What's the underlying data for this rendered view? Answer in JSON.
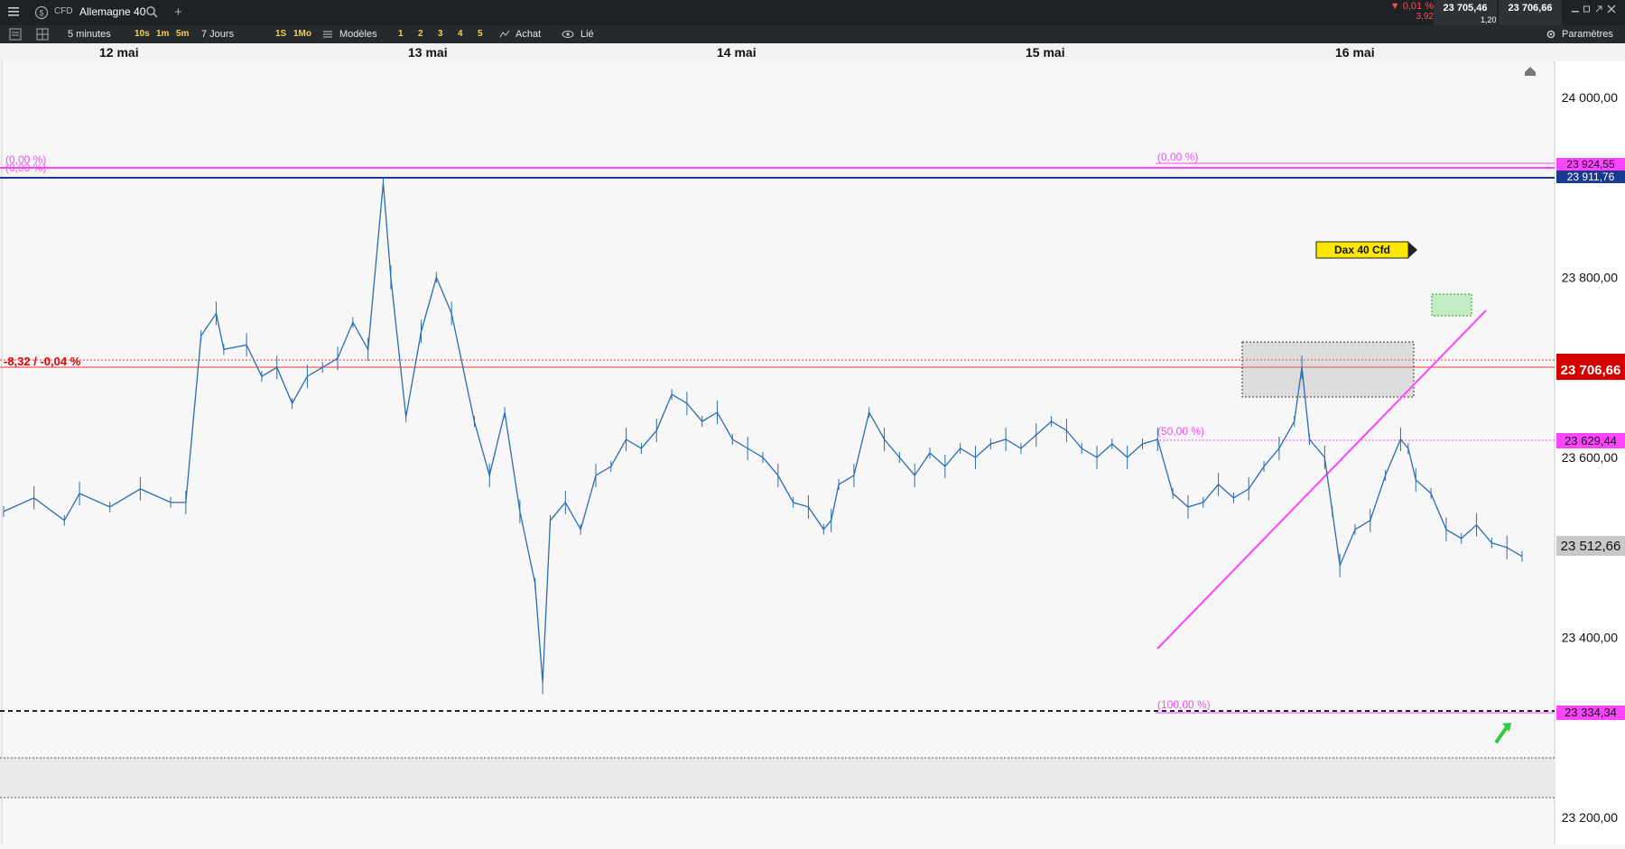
{
  "header": {
    "menu_icon": "hamburger-icon",
    "badge_icon": "dollar-circle-icon",
    "instrument_type": "CFD",
    "instrument_name": "Allemagne 40",
    "search_icon": "search-icon",
    "add_icon": "plus-icon",
    "change_pct": "▼ 0,01 %",
    "change_abs": "3,92",
    "bid": "23 705,46",
    "ask": "23 706,66",
    "spread": "1,20",
    "window_icons": [
      "minimize-icon",
      "restore-icon",
      "popout-icon",
      "close-icon"
    ]
  },
  "toolbar": {
    "interval": "5 minutes",
    "quick_intervals": [
      "10s",
      "1m",
      "5m"
    ],
    "range": "7 Jours",
    "quick_ranges": [
      "1S",
      "1Mo"
    ],
    "layouts": [
      "1",
      "2",
      "3",
      "4",
      "5"
    ],
    "models_label": "Modèles",
    "buy_label": "Achat",
    "linked_label": "Lié",
    "settings_label": "Paramètres"
  },
  "chart_data": {
    "type": "line",
    "x_labels": [
      "12 mai",
      "13 mai",
      "14 mai",
      "15 mai",
      "16 mai"
    ],
    "y_ticks": [
      24000,
      23800,
      23600,
      23400,
      23200
    ],
    "y_tick_labels": [
      "24 000,00",
      "23 800,00",
      "23 600,00",
      "23 400,00",
      "23 200,00"
    ],
    "ylim": [
      23170,
      24040
    ],
    "series": [
      {
        "points": [
          [
            0.0,
            23540
          ],
          [
            0.02,
            23555
          ],
          [
            0.04,
            23530
          ],
          [
            0.05,
            23560
          ],
          [
            0.07,
            23545
          ],
          [
            0.09,
            23565
          ],
          [
            0.11,
            23550
          ],
          [
            0.12,
            23550
          ],
          [
            0.13,
            23735
          ],
          [
            0.14,
            23760
          ],
          [
            0.145,
            23720
          ],
          [
            0.16,
            23725
          ],
          [
            0.17,
            23690
          ],
          [
            0.18,
            23700
          ],
          [
            0.19,
            23660
          ],
          [
            0.2,
            23690
          ],
          [
            0.21,
            23700
          ],
          [
            0.22,
            23710
          ],
          [
            0.23,
            23750
          ],
          [
            0.24,
            23720
          ],
          [
            0.25,
            23905
          ],
          [
            0.255,
            23800
          ],
          [
            0.265,
            23645
          ],
          [
            0.275,
            23740
          ],
          [
            0.285,
            23800
          ],
          [
            0.295,
            23760
          ],
          [
            0.31,
            23640
          ],
          [
            0.32,
            23580
          ],
          [
            0.33,
            23650
          ],
          [
            0.34,
            23540
          ],
          [
            0.35,
            23460
          ],
          [
            0.355,
            23350
          ],
          [
            0.36,
            23530
          ],
          [
            0.37,
            23550
          ],
          [
            0.38,
            23520
          ],
          [
            0.39,
            23580
          ],
          [
            0.4,
            23590
          ],
          [
            0.41,
            23620
          ],
          [
            0.42,
            23610
          ],
          [
            0.43,
            23630
          ],
          [
            0.44,
            23670
          ],
          [
            0.45,
            23660
          ],
          [
            0.46,
            23640
          ],
          [
            0.47,
            23650
          ],
          [
            0.48,
            23620
          ],
          [
            0.49,
            23610
          ],
          [
            0.5,
            23600
          ],
          [
            0.51,
            23580
          ],
          [
            0.52,
            23550
          ],
          [
            0.53,
            23545
          ],
          [
            0.54,
            23520
          ],
          [
            0.545,
            23530
          ],
          [
            0.55,
            23570
          ],
          [
            0.56,
            23580
          ],
          [
            0.57,
            23650
          ],
          [
            0.58,
            23620
          ],
          [
            0.59,
            23600
          ],
          [
            0.6,
            23580
          ],
          [
            0.61,
            23605
          ],
          [
            0.62,
            23590
          ],
          [
            0.63,
            23610
          ],
          [
            0.64,
            23600
          ],
          [
            0.65,
            23615
          ],
          [
            0.66,
            23620
          ],
          [
            0.67,
            23610
          ],
          [
            0.68,
            23625
          ],
          [
            0.69,
            23640
          ],
          [
            0.7,
            23630
          ],
          [
            0.71,
            23610
          ],
          [
            0.72,
            23600
          ],
          [
            0.73,
            23615
          ],
          [
            0.74,
            23600
          ],
          [
            0.75,
            23615
          ],
          [
            0.76,
            23620
          ],
          [
            0.77,
            23560
          ],
          [
            0.78,
            23545
          ],
          [
            0.79,
            23550
          ],
          [
            0.8,
            23570
          ],
          [
            0.81,
            23555
          ],
          [
            0.82,
            23565
          ],
          [
            0.83,
            23590
          ],
          [
            0.84,
            23610
          ],
          [
            0.85,
            23640
          ],
          [
            0.855,
            23700
          ],
          [
            0.86,
            23620
          ],
          [
            0.87,
            23600
          ],
          [
            0.875,
            23540
          ],
          [
            0.88,
            23480
          ],
          [
            0.89,
            23520
          ],
          [
            0.9,
            23530
          ],
          [
            0.91,
            23580
          ],
          [
            0.92,
            23620
          ],
          [
            0.925,
            23610
          ],
          [
            0.93,
            23575
          ],
          [
            0.94,
            23560
          ],
          [
            0.95,
            23520
          ],
          [
            0.96,
            23510
          ],
          [
            0.97,
            23525
          ],
          [
            0.98,
            23505
          ],
          [
            0.99,
            23500
          ],
          [
            1.0,
            23490
          ]
        ]
      }
    ]
  },
  "levels": {
    "fib_top_pct": "(0,00 %)",
    "fib_top_pct_left": "(0,00 %)",
    "fib_mid_pct": "(50,00 %)",
    "fib_bottom_pct": "(100,00 %)",
    "fib_top_value": "23 924,55",
    "blue_line_value": "23 911,76",
    "fib_mid_value": "23 629,44",
    "fib_bottom_value": "23 334,34",
    "last_price": "23 706,66",
    "grey_price": "23 512,66",
    "red_line_value": "23 714,98",
    "change_label": "-8,32 / -0,04 %",
    "annotation": "Dax 40 Cfd"
  },
  "colors": {
    "up_red": "#ff4d4d",
    "magenta": "#ff44ff",
    "blue_line": "#1a3a8f",
    "candle_blue": "#2b6cb0",
    "price_red": "#d40000",
    "label_yellow": "#ffe800"
  }
}
